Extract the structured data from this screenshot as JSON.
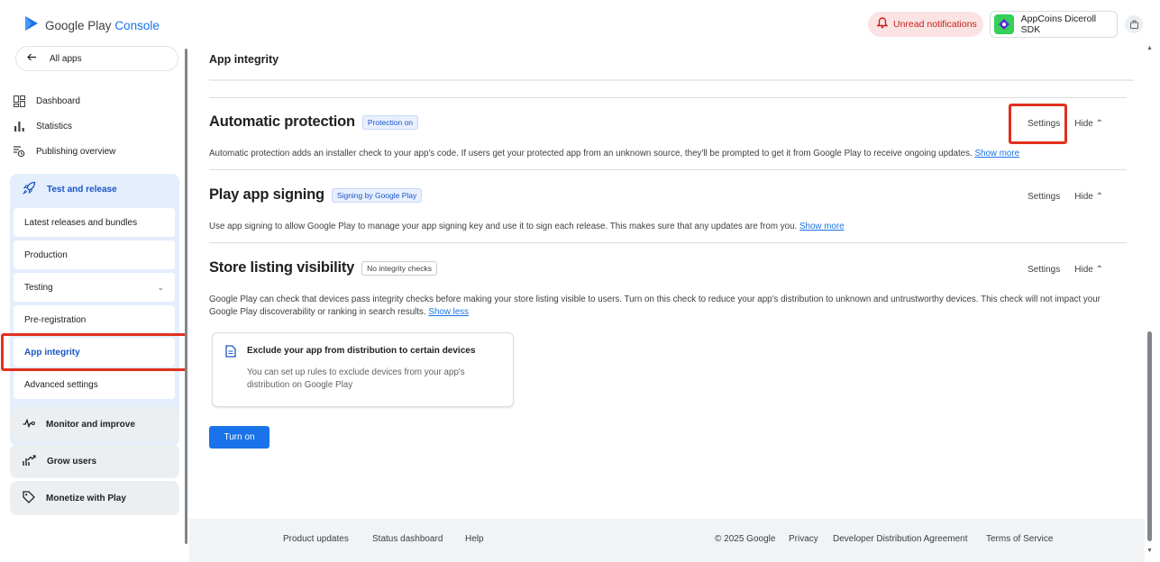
{
  "header": {
    "logo_google_play": "Google Play",
    "logo_console": "Console",
    "notifications_label": "Unread notifications",
    "app_name": "AppCoins Diceroll SDK"
  },
  "sidebar": {
    "all_apps": "All apps",
    "items": [
      {
        "label": "Dashboard",
        "icon": "dashboard-icon"
      },
      {
        "label": "Statistics",
        "icon": "bar-chart-icon"
      },
      {
        "label": "Publishing overview",
        "icon": "publishing-overview-icon"
      }
    ],
    "group": {
      "label": "Test and release",
      "icon": "rocket-icon",
      "subitems": [
        {
          "label": "Latest releases and bundles"
        },
        {
          "label": "Production"
        },
        {
          "label": "Testing"
        },
        {
          "label": "Pre-registration"
        },
        {
          "label": "App integrity"
        },
        {
          "label": "Advanced settings"
        }
      ]
    },
    "collapsed_groups": [
      {
        "label": "Monitor and improve",
        "icon": "pulse-icon"
      },
      {
        "label": "Grow users",
        "icon": "grow-users-icon"
      },
      {
        "label": "Monetize with Play",
        "icon": "tag-icon"
      }
    ]
  },
  "main": {
    "page_title": "App integrity",
    "sections": [
      {
        "title": "Automatic protection",
        "badge": "Protection on",
        "settings": "Settings",
        "hide": "Hide",
        "description": "Automatic protection adds an installer check to your app's code. If users get your protected app from an unknown source, they'll be prompted to get it from Google Play to receive ongoing updates.",
        "link": "Show more"
      },
      {
        "title": "Play app signing",
        "badge": "Signing by Google Play",
        "settings": "Settings",
        "hide": "Hide",
        "description": "Use app signing to allow Google Play to manage your app signing key and use it to sign each release. This makes sure that any updates are from you.",
        "link": "Show more"
      },
      {
        "title": "Store listing visibility",
        "badge": "No integrity checks",
        "settings": "Settings",
        "hide": "Hide",
        "description": "Google Play can check that devices pass integrity checks before making your store listing visible to users. Turn on this check to reduce your app's distribution to unknown and untrustworthy devices. This check will not impact your Google Play discoverability or ranking in search results.",
        "link": "Show less"
      }
    ],
    "card": {
      "title": "Exclude your app from distribution to certain devices",
      "body": "You can set up rules to exclude devices from your app's distribution on Google Play",
      "icon": "document-icon"
    },
    "turn_on_button": "Turn on"
  },
  "footer": {
    "links": [
      "Product updates",
      "Status dashboard",
      "Help"
    ],
    "copyright": "© 2025 Google",
    "right_links": [
      "Privacy",
      "Developer Distribution Agreement",
      "Terms of Service"
    ]
  },
  "colors": {
    "accent": "#1a73e8",
    "highlight_box": "#e0301e",
    "nav_group_bg": "#e4eefc"
  }
}
